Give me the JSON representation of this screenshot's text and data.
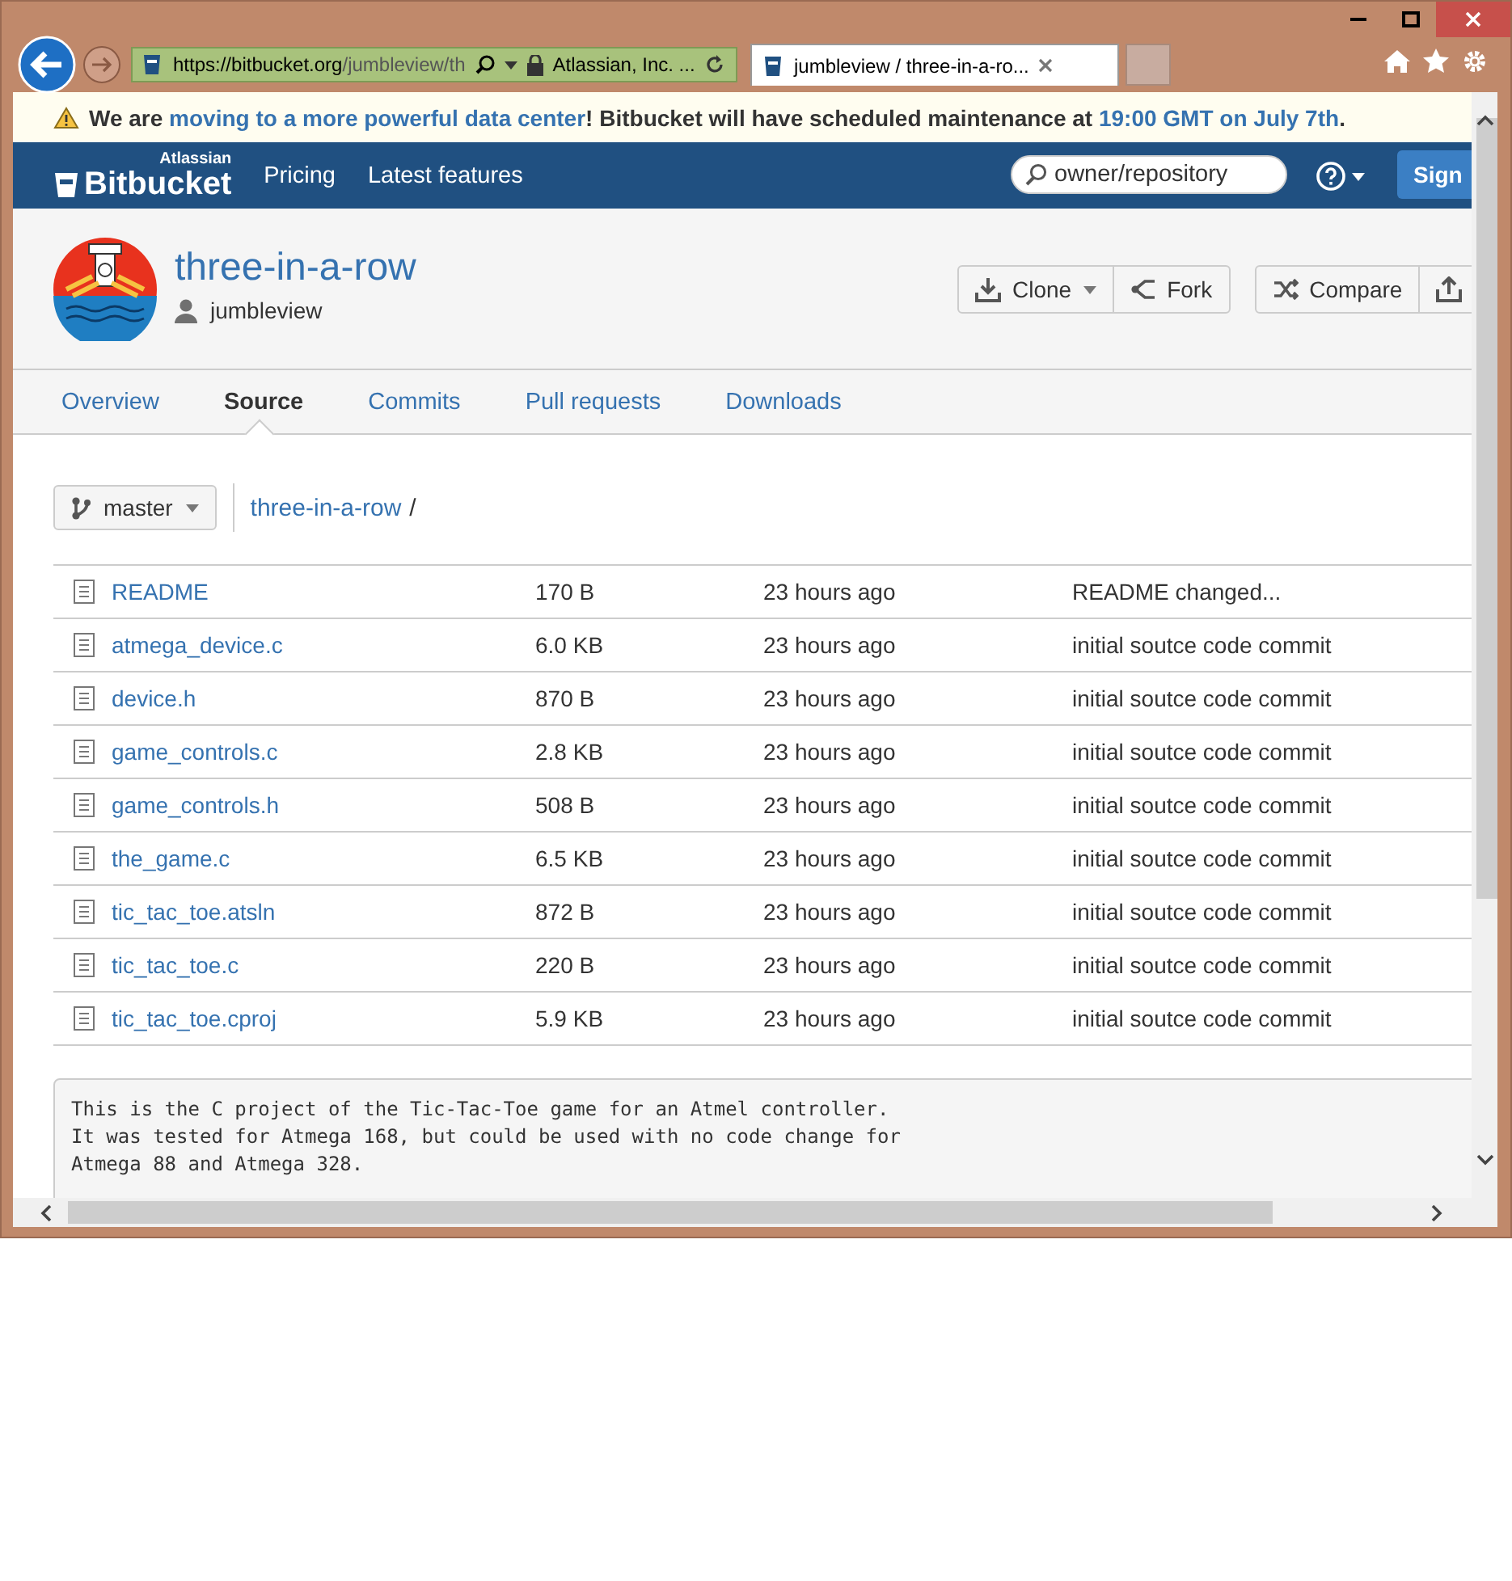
{
  "browser": {
    "url_host": "https://bitbucket.org",
    "url_path": "/jumbleview/th",
    "certificate": "Atlassian, Inc. ...",
    "tabs": [
      {
        "label": "jumbleview / three-in-a-ro...",
        "selected": true
      }
    ]
  },
  "notice": {
    "parts": [
      {
        "kind": "plain",
        "text": "We are "
      },
      {
        "kind": "link",
        "text": "moving to a more powerful data center"
      },
      {
        "kind": "plain",
        "text": "! Bitbucket will have scheduled maintenance at "
      },
      {
        "kind": "link",
        "text": "19:00 GMT on July 7th"
      },
      {
        "kind": "plain",
        "text": "."
      }
    ]
  },
  "nav": {
    "brand_top": "Atlassian",
    "brand": "Bitbucket",
    "links": [
      "Pricing",
      "Latest features"
    ],
    "search": {
      "placeholder": "owner/repository"
    },
    "sign_in": "Sign"
  },
  "repo": {
    "name": "three-in-a-row",
    "owner": "jumbleview",
    "actions": [
      {
        "label": "Clone",
        "caret": true
      },
      {
        "label": "Fork",
        "caret": false
      },
      {
        "label": "Compare",
        "caret": false
      },
      {
        "caret": false
      }
    ]
  },
  "tabs": [
    {
      "label": "Overview",
      "selected": false
    },
    {
      "label": "Source",
      "selected": true
    },
    {
      "label": "Commits",
      "selected": false
    },
    {
      "label": "Pull requests",
      "selected": false
    },
    {
      "label": "Downloads",
      "selected": false
    }
  ],
  "branch": "master",
  "breadcrumb": {
    "path": "three-in-a-row",
    "separator": "/"
  },
  "files": [
    {
      "name": "README",
      "size": "170 B",
      "modified": "23 hours ago",
      "message": "README changed..."
    },
    {
      "name": "atmega_device.c",
      "size": "6.0 KB",
      "modified": "23 hours ago",
      "message": "initial soutce code commit"
    },
    {
      "name": "device.h",
      "size": "870 B",
      "modified": "23 hours ago",
      "message": "initial soutce code commit"
    },
    {
      "name": "game_controls.c",
      "size": "2.8 KB",
      "modified": "23 hours ago",
      "message": "initial soutce code commit"
    },
    {
      "name": "game_controls.h",
      "size": "508 B",
      "modified": "23 hours ago",
      "message": "initial soutce code commit"
    },
    {
      "name": "the_game.c",
      "size": "6.5 KB",
      "modified": "23 hours ago",
      "message": "initial soutce code commit"
    },
    {
      "name": "tic_tac_toe.atsln",
      "size": "872 B",
      "modified": "23 hours ago",
      "message": "initial soutce code commit"
    },
    {
      "name": "tic_tac_toe.c",
      "size": "220 B",
      "modified": "23 hours ago",
      "message": "initial soutce code commit"
    },
    {
      "name": "tic_tac_toe.cproj",
      "size": "5.9 KB",
      "modified": "23 hours ago",
      "message": "initial soutce code commit"
    }
  ],
  "readme": [
    "This is the C project of the Tic-Tac-Toe game for an Atmel controller.",
    "It was tested for Atmega 168, but could be used with no code change for",
    "Atmega 88 and Atmega 328."
  ]
}
